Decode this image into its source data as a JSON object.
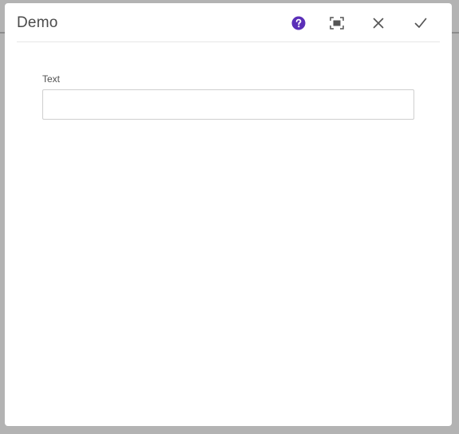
{
  "dialog": {
    "title": "Demo",
    "buttons": {
      "help": {
        "icon": "help-circle-icon",
        "color": "#5b2fb8"
      },
      "fullscreen": {
        "icon": "fullscreen-icon",
        "color": "#555555"
      },
      "close": {
        "icon": "close-icon",
        "color": "#555555"
      },
      "done": {
        "icon": "checkmark-icon",
        "color": "#555555"
      }
    }
  },
  "form": {
    "text_field": {
      "label": "Text",
      "value": "",
      "placeholder": ""
    }
  }
}
